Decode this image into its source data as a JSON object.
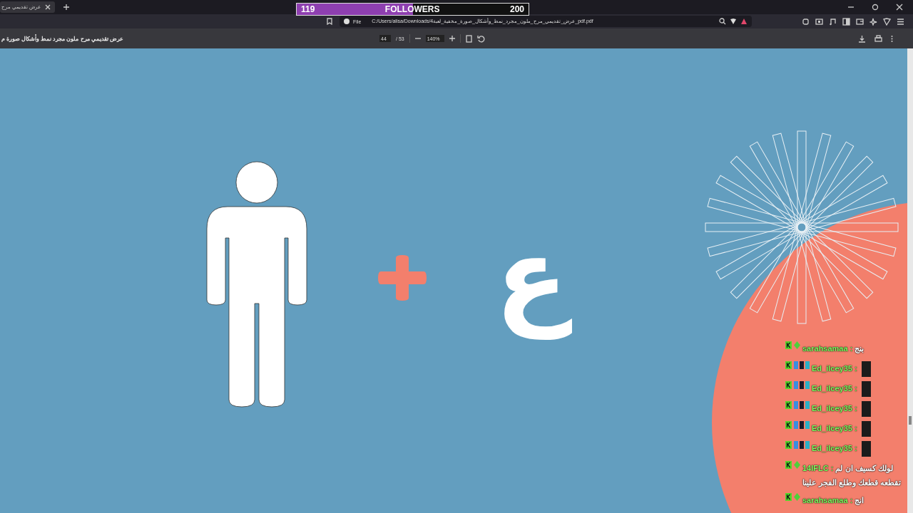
{
  "browser": {
    "tab": {
      "title": "عرض تقديمي مرح",
      "selected": true
    },
    "address": {
      "scheme": "File",
      "url": "C:/Users/alisa/Downloads/4عرض_تقديمي_مرح_ملون_مجرد_نمط_وأشكال_صورة_مخفية_لعبة_pdf.pdf"
    }
  },
  "pdf_toolbar": {
    "title": "عرض تقديمي مرح ملون مجرد نمط وأشكال صورة م",
    "page": "44",
    "pages": "/ 53",
    "zoom": "140%"
  },
  "follower_goal": {
    "current": "119",
    "label": "FOLLOWERS",
    "target": "200",
    "level": 0.5
  },
  "slide": {
    "letter": "ع"
  },
  "chat": [
    {
      "user": "sarahsamaa :",
      "kind": "plain",
      "message": "بنج"
    },
    {
      "user": "Ed_ilcey35 :",
      "kind": "emote"
    },
    {
      "user": "Ed_ilcey35 :",
      "kind": "emote"
    },
    {
      "user": "Ed_ilcey35 :",
      "kind": "emote"
    },
    {
      "user": "Ed_ilcey35 :",
      "kind": "emote"
    },
    {
      "user": "Ed_ilcey35 :",
      "kind": "emote"
    },
    {
      "user": "14IFLC :",
      "kind": "plain",
      "message": "لولك كسيف ان لم تقطعه قطعك وطلع الفجر علينا"
    },
    {
      "user": "sarahsamaa :",
      "kind": "plain",
      "message": "انج"
    }
  ]
}
